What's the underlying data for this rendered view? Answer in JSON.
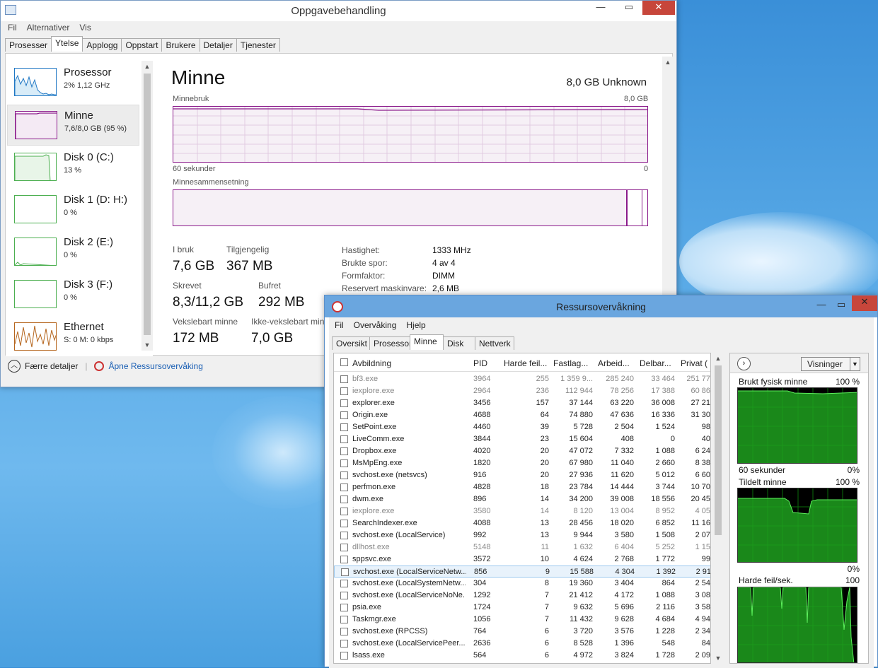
{
  "task_manager": {
    "title": "Oppgavebehandling",
    "menu": [
      "Fil",
      "Alternativer",
      "Vis"
    ],
    "tabs": [
      "Prosesser",
      "Ytelse",
      "Applogg",
      "Oppstart",
      "Brukere",
      "Detaljer",
      "Tjenester"
    ],
    "active_tab": "Ytelse",
    "sidebar": [
      {
        "name": "Prosessor",
        "sub": "2% 1,12 GHz",
        "color": "#1f77c4"
      },
      {
        "name": "Minne",
        "sub": "7,6/8,0 GB (95 %)",
        "color": "#8b1a8b"
      },
      {
        "name": "Disk 0 (C:)",
        "sub": "13 %",
        "color": "#4caf50"
      },
      {
        "name": "Disk 1 (D: H:)",
        "sub": "0 %",
        "color": "#4caf50"
      },
      {
        "name": "Disk 2 (E:)",
        "sub": "0 %",
        "color": "#4caf50"
      },
      {
        "name": "Disk 3 (F:)",
        "sub": "0 %",
        "color": "#4caf50"
      },
      {
        "name": "Ethernet",
        "sub": "S: 0 M: 0 kbps",
        "color": "#b5651d"
      }
    ],
    "main": {
      "title": "Minne",
      "spec": "8,0 GB Unknown",
      "usage_label": "Minnebruk",
      "usage_max": "8,0 GB",
      "time_label": "60 sekunder",
      "time_end": "0",
      "composition_label": "Minnesammensetning",
      "stats": [
        {
          "label": "I bruk",
          "value": "7,6 GB"
        },
        {
          "label": "Tilgjengelig",
          "value": "367 MB"
        },
        {
          "label": "Skrevet",
          "value": "8,3/11,2 GB"
        },
        {
          "label": "Bufret",
          "value": "292 MB"
        },
        {
          "label": "Vekslebart minne",
          "value": "172 MB"
        },
        {
          "label": "Ikke-vekslebart minne",
          "value": "7,0 GB"
        }
      ],
      "details": [
        {
          "k": "Hastighet:",
          "v": "1333 MHz"
        },
        {
          "k": "Brukte spor:",
          "v": "4 av 4"
        },
        {
          "k": "Formfaktor:",
          "v": "DIMM"
        },
        {
          "k": "Reservert maskinvare:",
          "v": "2,6 MB"
        }
      ]
    },
    "footer": {
      "fewer": "Færre detaljer",
      "open_rm": "Åpne Ressursovervåking"
    }
  },
  "resource_monitor": {
    "title": "Ressursovervåkning",
    "menu": [
      "Fil",
      "Overvåking",
      "Hjelp"
    ],
    "tabs": [
      "Oversikt",
      "Prosessor",
      "Minne",
      "Disk",
      "Nettverk"
    ],
    "active_tab": "Minne",
    "columns": [
      "Avbildning",
      "PID",
      "Harde feil...",
      "Fastlag...",
      "Arbeid...",
      "Delbar...",
      "Privat ("
    ],
    "rows": [
      {
        "name": "bf3.exe",
        "pid": "3964",
        "hf": "255",
        "fl": "1 359 9...",
        "ar": "285 240",
        "de": "33 464",
        "pr": "251 77",
        "dim": true
      },
      {
        "name": "iexplore.exe",
        "pid": "2964",
        "hf": "236",
        "fl": "112 944",
        "ar": "78 256",
        "de": "17 388",
        "pr": "60 86",
        "dim": true
      },
      {
        "name": "explorer.exe",
        "pid": "3456",
        "hf": "157",
        "fl": "37 144",
        "ar": "63 220",
        "de": "36 008",
        "pr": "27 21"
      },
      {
        "name": "Origin.exe",
        "pid": "4688",
        "hf": "64",
        "fl": "74 880",
        "ar": "47 636",
        "de": "16 336",
        "pr": "31 30"
      },
      {
        "name": "SetPoint.exe",
        "pid": "4460",
        "hf": "39",
        "fl": "5 728",
        "ar": "2 504",
        "de": "1 524",
        "pr": "98"
      },
      {
        "name": "LiveComm.exe",
        "pid": "3844",
        "hf": "23",
        "fl": "15 604",
        "ar": "408",
        "de": "0",
        "pr": "40"
      },
      {
        "name": "Dropbox.exe",
        "pid": "4020",
        "hf": "20",
        "fl": "47 072",
        "ar": "7 332",
        "de": "1 088",
        "pr": "6 24"
      },
      {
        "name": "MsMpEng.exe",
        "pid": "1820",
        "hf": "20",
        "fl": "67 980",
        "ar": "11 040",
        "de": "2 660",
        "pr": "8 38"
      },
      {
        "name": "svchost.exe (netsvcs)",
        "pid": "916",
        "hf": "20",
        "fl": "27 936",
        "ar": "11 620",
        "de": "5 012",
        "pr": "6 60"
      },
      {
        "name": "perfmon.exe",
        "pid": "4828",
        "hf": "18",
        "fl": "23 784",
        "ar": "14 444",
        "de": "3 744",
        "pr": "10 70"
      },
      {
        "name": "dwm.exe",
        "pid": "896",
        "hf": "14",
        "fl": "34 200",
        "ar": "39 008",
        "de": "18 556",
        "pr": "20 45"
      },
      {
        "name": "iexplore.exe",
        "pid": "3580",
        "hf": "14",
        "fl": "8 120",
        "ar": "13 004",
        "de": "8 952",
        "pr": "4 05",
        "dim": true
      },
      {
        "name": "SearchIndexer.exe",
        "pid": "4088",
        "hf": "13",
        "fl": "28 456",
        "ar": "18 020",
        "de": "6 852",
        "pr": "11 16"
      },
      {
        "name": "svchost.exe (LocalService)",
        "pid": "992",
        "hf": "13",
        "fl": "9 944",
        "ar": "3 580",
        "de": "1 508",
        "pr": "2 07"
      },
      {
        "name": "dllhost.exe",
        "pid": "5148",
        "hf": "11",
        "fl": "1 632",
        "ar": "6 404",
        "de": "5 252",
        "pr": "1 15",
        "dim": true
      },
      {
        "name": "sppsvc.exe",
        "pid": "3572",
        "hf": "10",
        "fl": "4 624",
        "ar": "2 768",
        "de": "1 772",
        "pr": "99"
      },
      {
        "name": "svchost.exe (LocalServiceNetw...",
        "pid": "856",
        "hf": "9",
        "fl": "15 588",
        "ar": "4 304",
        "de": "1 392",
        "pr": "2 91",
        "hl": true
      },
      {
        "name": "svchost.exe (LocalSystemNetw...",
        "pid": "304",
        "hf": "8",
        "fl": "19 360",
        "ar": "3 404",
        "de": "864",
        "pr": "2 54"
      },
      {
        "name": "svchost.exe (LocalServiceNoNe...",
        "pid": "1292",
        "hf": "7",
        "fl": "21 412",
        "ar": "4 172",
        "de": "1 088",
        "pr": "3 08"
      },
      {
        "name": "psia.exe",
        "pid": "1724",
        "hf": "7",
        "fl": "9 632",
        "ar": "5 696",
        "de": "2 116",
        "pr": "3 58"
      },
      {
        "name": "Taskmgr.exe",
        "pid": "1056",
        "hf": "7",
        "fl": "11 432",
        "ar": "9 628",
        "de": "4 684",
        "pr": "4 94"
      },
      {
        "name": "svchost.exe (RPCSS)",
        "pid": "764",
        "hf": "6",
        "fl": "3 720",
        "ar": "3 576",
        "de": "1 228",
        "pr": "2 34"
      },
      {
        "name": "svchost.exe (LocalServicePeer...",
        "pid": "2636",
        "hf": "6",
        "fl": "8 528",
        "ar": "1 396",
        "de": "548",
        "pr": "84"
      },
      {
        "name": "lsass.exe",
        "pid": "564",
        "hf": "6",
        "fl": "4 972",
        "ar": "3 824",
        "de": "1 728",
        "pr": "2 09"
      }
    ],
    "views_button": "Visninger",
    "graphs": [
      {
        "label": "Brukt fysisk minne",
        "max": "100 %",
        "bottom_left": "60 sekunder",
        "bottom_right": "0%"
      },
      {
        "label": "Tildelt minne",
        "max": "100 %",
        "bottom_right": "0%"
      },
      {
        "label": "Harde feil/sek.",
        "max": "100"
      }
    ]
  }
}
